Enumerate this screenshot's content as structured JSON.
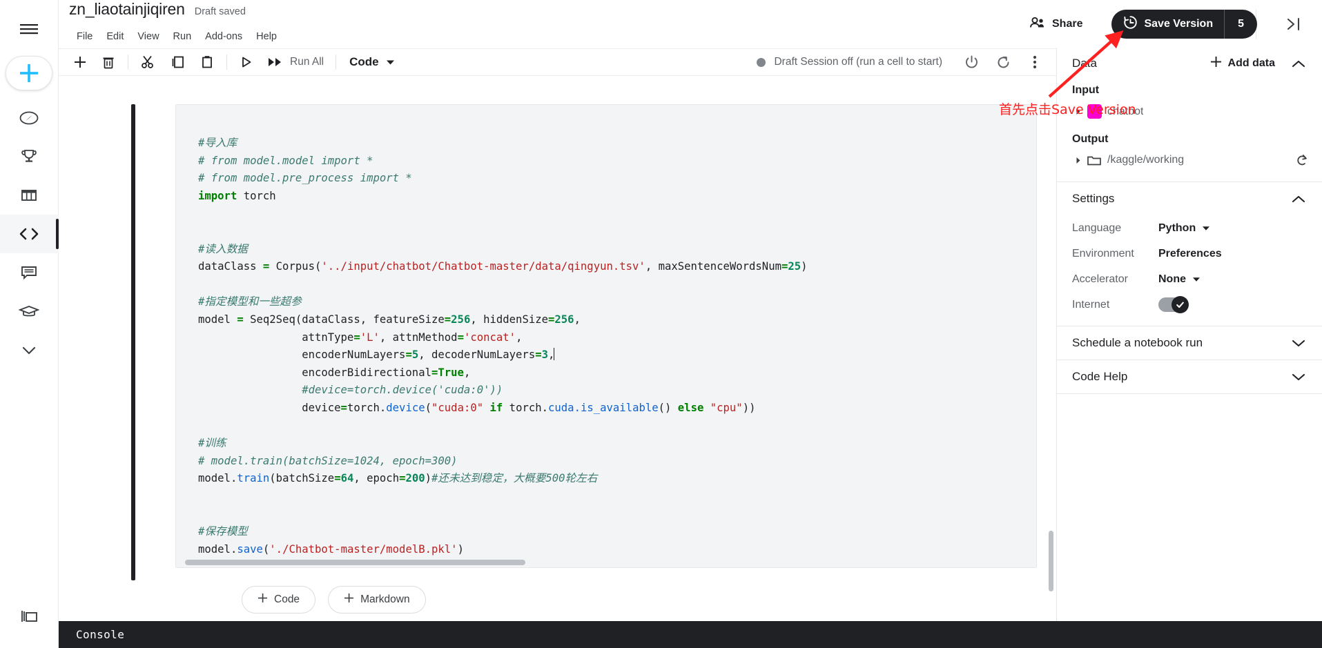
{
  "left_rail": {
    "items": [
      {
        "name": "menu-icon",
        "label": "Menu"
      },
      {
        "name": "create-icon",
        "label": "Create"
      },
      {
        "name": "compass-icon",
        "label": "Home"
      },
      {
        "name": "trophy-icon",
        "label": "Competitions"
      },
      {
        "name": "table-icon",
        "label": "Datasets"
      },
      {
        "name": "code-brackets-icon",
        "label": "Code"
      },
      {
        "name": "discussion-icon",
        "label": "Discussions"
      },
      {
        "name": "graduation-cap-icon",
        "label": "Learn"
      },
      {
        "name": "chevron-down-icon",
        "label": "More"
      }
    ],
    "bottom_item": {
      "name": "layers-icon",
      "label": "Your Work"
    }
  },
  "header": {
    "title": "zn_liaotainjiqiren",
    "save_state": "Draft saved",
    "menus": [
      "File",
      "Edit",
      "View",
      "Run",
      "Add-ons",
      "Help"
    ],
    "share_label": "Share",
    "share_icon": "people-icon",
    "save_version_label": "Save Version",
    "save_version_icon": "history-clock-icon",
    "save_version_count": "5",
    "collapse_icon": "collapse-panel-icon"
  },
  "toolbar": {
    "buttons": [
      {
        "name": "add-cell-icon",
        "label": "Add cell"
      },
      {
        "name": "delete-cell-icon",
        "label": "Delete cell"
      },
      {
        "name": "cut-icon",
        "label": "Cut"
      },
      {
        "name": "copy-icon",
        "label": "Copy"
      },
      {
        "name": "paste-icon",
        "label": "Paste"
      },
      {
        "name": "run-icon",
        "label": "Run"
      },
      {
        "name": "run-all-icon",
        "label": "Run All"
      }
    ],
    "run_all_label": "Run All",
    "cell_type": "Code",
    "cell_type_caret": "chevron-down-icon",
    "session_status": "Draft Session off (run a cell to start)",
    "power_icon": "power-icon",
    "restart_icon": "restart-icon",
    "more_icon": "more-vertical-icon"
  },
  "notebook": {
    "cell_lines": [
      {
        "segments": [
          {
            "t": "#导入库",
            "c": "tok-com"
          }
        ]
      },
      {
        "segments": [
          {
            "t": "# from model.model import *",
            "c": "tok-com"
          }
        ]
      },
      {
        "segments": [
          {
            "t": "# from model.pre_process import *",
            "c": "tok-com"
          }
        ]
      },
      {
        "segments": [
          {
            "t": "import",
            "c": "tok-kw"
          },
          {
            "t": " torch",
            "c": ""
          }
        ]
      },
      {
        "segments": []
      },
      {
        "segments": []
      },
      {
        "segments": [
          {
            "t": "#读入数据",
            "c": "tok-com"
          }
        ]
      },
      {
        "segments": [
          {
            "t": "dataClass ",
            "c": ""
          },
          {
            "t": "=",
            "c": "tok-op"
          },
          {
            "t": " Corpus(",
            "c": ""
          },
          {
            "t": "'../input/chatbot/Chatbot-master/data/qingyun.tsv'",
            "c": "tok-str"
          },
          {
            "t": ", maxSentenceWordsNum",
            "c": ""
          },
          {
            "t": "=",
            "c": "tok-op"
          },
          {
            "t": "25",
            "c": "tok-num"
          },
          {
            "t": ")",
            "c": ""
          }
        ]
      },
      {
        "segments": []
      },
      {
        "segments": [
          {
            "t": "#指定模型和一些超参",
            "c": "tok-com"
          }
        ]
      },
      {
        "segments": [
          {
            "t": "model ",
            "c": ""
          },
          {
            "t": "=",
            "c": "tok-op"
          },
          {
            "t": " Seq2Seq(dataClass, featureSize",
            "c": ""
          },
          {
            "t": "=",
            "c": "tok-op"
          },
          {
            "t": "256",
            "c": "tok-num"
          },
          {
            "t": ", hiddenSize",
            "c": ""
          },
          {
            "t": "=",
            "c": "tok-op"
          },
          {
            "t": "256",
            "c": "tok-num"
          },
          {
            "t": ",",
            "c": ""
          }
        ]
      },
      {
        "segments": [
          {
            "t": "                attnType",
            "c": ""
          },
          {
            "t": "=",
            "c": "tok-op"
          },
          {
            "t": "'L'",
            "c": "tok-str"
          },
          {
            "t": ", attnMethod",
            "c": ""
          },
          {
            "t": "=",
            "c": "tok-op"
          },
          {
            "t": "'concat'",
            "c": "tok-str"
          },
          {
            "t": ",",
            "c": ""
          }
        ]
      },
      {
        "segments": [
          {
            "t": "                encoderNumLayers",
            "c": ""
          },
          {
            "t": "=",
            "c": "tok-op"
          },
          {
            "t": "5",
            "c": "tok-num"
          },
          {
            "t": ", decoderNumLayers",
            "c": ""
          },
          {
            "t": "=",
            "c": "tok-op"
          },
          {
            "t": "3",
            "c": "tok-num"
          },
          {
            "t": ",",
            "c": ""
          }
        ],
        "caret": true
      },
      {
        "segments": [
          {
            "t": "                encoderBidirectional",
            "c": ""
          },
          {
            "t": "=",
            "c": "tok-op"
          },
          {
            "t": "True",
            "c": "tok-bool"
          },
          {
            "t": ",",
            "c": ""
          }
        ]
      },
      {
        "segments": [
          {
            "t": "                #device=torch.device('cuda:0'))",
            "c": "tok-com"
          }
        ]
      },
      {
        "segments": [
          {
            "t": "                device",
            "c": ""
          },
          {
            "t": "=",
            "c": "tok-op"
          },
          {
            "t": "torch.",
            "c": ""
          },
          {
            "t": "device",
            "c": "tok-fn"
          },
          {
            "t": "(",
            "c": ""
          },
          {
            "t": "\"cuda:0\"",
            "c": "tok-str"
          },
          {
            "t": " ",
            "c": ""
          },
          {
            "t": "if",
            "c": "tok-kw"
          },
          {
            "t": " torch.",
            "c": ""
          },
          {
            "t": "cuda.is_available",
            "c": "tok-fn"
          },
          {
            "t": "() ",
            "c": ""
          },
          {
            "t": "else",
            "c": "tok-kw"
          },
          {
            "t": " ",
            "c": ""
          },
          {
            "t": "\"cpu\"",
            "c": "tok-str"
          },
          {
            "t": "))",
            "c": ""
          }
        ]
      },
      {
        "segments": []
      },
      {
        "segments": [
          {
            "t": "#训练",
            "c": "tok-com"
          }
        ]
      },
      {
        "segments": [
          {
            "t": "# model.train(batchSize=1024, epoch=300)",
            "c": "tok-com"
          }
        ]
      },
      {
        "segments": [
          {
            "t": "model.",
            "c": ""
          },
          {
            "t": "train",
            "c": "tok-fn"
          },
          {
            "t": "(batchSize",
            "c": ""
          },
          {
            "t": "=",
            "c": "tok-op"
          },
          {
            "t": "64",
            "c": "tok-num"
          },
          {
            "t": ", epoch",
            "c": ""
          },
          {
            "t": "=",
            "c": "tok-op"
          },
          {
            "t": "200",
            "c": "tok-num"
          },
          {
            "t": ")",
            "c": ""
          },
          {
            "t": "#还未达到稳定，大概要500轮左右",
            "c": "tok-com"
          }
        ]
      },
      {
        "segments": []
      },
      {
        "segments": []
      },
      {
        "segments": [
          {
            "t": "#保存模型",
            "c": "tok-com"
          }
        ]
      },
      {
        "segments": [
          {
            "t": "model.",
            "c": ""
          },
          {
            "t": "save",
            "c": "tok-fn"
          },
          {
            "t": "(",
            "c": ""
          },
          {
            "t": "'./Chatbot-master/modelB.pkl'",
            "c": "tok-str"
          },
          {
            "t": ")",
            "c": ""
          }
        ]
      }
    ],
    "add_code_label": "Code",
    "add_markdown_label": "Markdown",
    "add_icon": "plus-icon"
  },
  "console": {
    "label": "Console"
  },
  "right_panel": {
    "data": {
      "title": "Data",
      "add_label": "Add data",
      "add_icon": "plus-icon",
      "collapse_icon": "chevron-up-icon",
      "input_label": "Input",
      "input_items": [
        {
          "label": "chatbot",
          "icon": "dataset-swatch-icon",
          "caret": "caret-right-icon"
        }
      ],
      "output_label": "Output",
      "output_items": [
        {
          "label": "/kaggle/working",
          "icon": "folder-icon",
          "caret": "caret-right-icon",
          "action": "refresh-icon"
        }
      ]
    },
    "settings": {
      "title": "Settings",
      "collapse_icon": "chevron-up-icon",
      "rows": [
        {
          "label": "Language",
          "value": "Python",
          "control": "dropdown"
        },
        {
          "label": "Environment",
          "value": "Preferences",
          "control": "link"
        },
        {
          "label": "Accelerator",
          "value": "None",
          "control": "dropdown"
        },
        {
          "label": "Internet",
          "value": "on",
          "control": "toggle"
        }
      ]
    },
    "collapsibles": [
      {
        "title": "Schedule a notebook run",
        "icon": "chevron-down-icon"
      },
      {
        "title": "Code Help",
        "icon": "chevron-down-icon"
      }
    ]
  },
  "annotation": {
    "text": "首先点击Save Version",
    "color": "#ff2020",
    "arrow": "red-arrow-pointing-to-save-version"
  },
  "colors": {
    "accent_blue": "#20beff",
    "dark": "#202124",
    "muted": "#5f6368",
    "cell_bg": "#f3f4f6",
    "annotation_red": "#ff2020",
    "dataset_magenta": "#ff00e1"
  }
}
